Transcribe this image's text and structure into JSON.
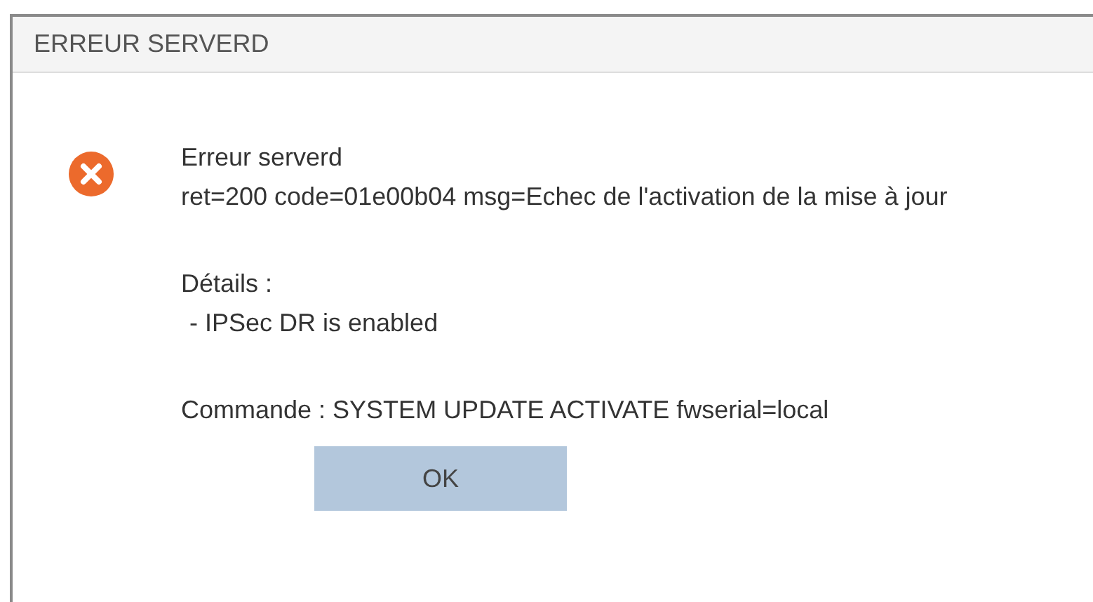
{
  "dialog": {
    "title": "ERREUR SERVERD",
    "heading": "Erreur serverd",
    "message": "ret=200 code=01e00b04 msg=Echec de l'activation de la mise à jour",
    "details_label": "Détails :",
    "details": [
      "- IPSec DR is enabled"
    ],
    "command": "Commande : SYSTEM UPDATE ACTIVATE fwserial=local",
    "buttons": [
      "OK"
    ]
  }
}
